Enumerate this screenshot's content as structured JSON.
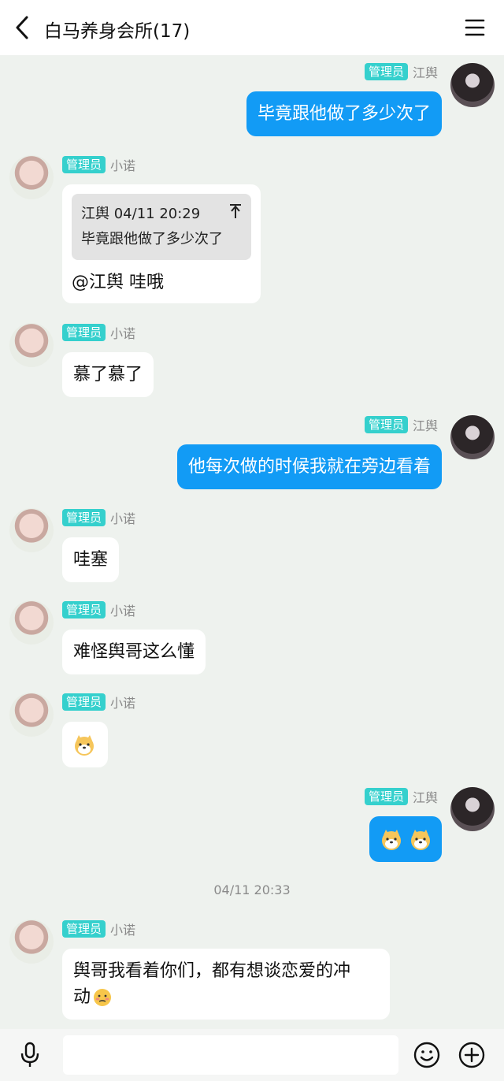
{
  "header": {
    "title": "白马养身会所(17)"
  },
  "badge_label": "管理员",
  "users": {
    "jiangyu": "江舆",
    "xiaonuo": "小诺"
  },
  "messages": {
    "m1": "毕竟跟他做了多少次了",
    "m2_quote_header": "江舆 04/11 20:29",
    "m2_quote_text": "毕竟跟他做了多少次了",
    "m2_text": "@江舆 哇哦",
    "m3": "慕了慕了",
    "m4": "他每次做的时候我就在旁边看着",
    "m5": "哇塞",
    "m6": "难怪舆哥这么懂",
    "m9_line1": "舆哥我看着你们，都有想谈恋爱的冲",
    "m9_line2": "动"
  },
  "timestamp_divider": "04/11 20:33",
  "input": {
    "placeholder": ""
  },
  "colors": {
    "accent_blue": "#129bf5",
    "badge_teal": "#35d0cd",
    "background": "#eef2ee"
  }
}
